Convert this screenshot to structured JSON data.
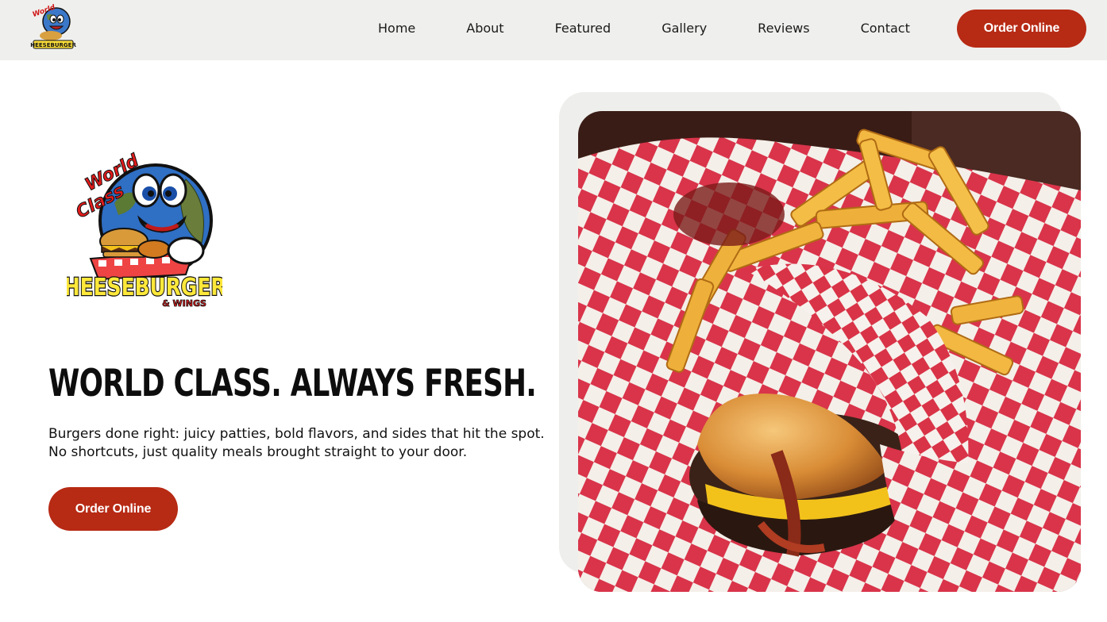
{
  "brand": {
    "logo_text_top": "World Class",
    "logo_text_main": "CHEESEBURGERS",
    "logo_text_sub": "& WINGS"
  },
  "nav": {
    "links": [
      "Home",
      "About",
      "Featured",
      "Gallery",
      "Reviews",
      "Contact"
    ],
    "order_label": "Order Online"
  },
  "hero": {
    "title": "WORLD CLASS. ALWAYS FRESH.",
    "description": "Burgers done right: juicy patties, bold flavors, and sides that hit the spot. No shortcuts, just quality meals brought straight to your door.",
    "order_label": "Order Online"
  },
  "colors": {
    "accent": "#b72a14",
    "nav_background": "#efefed",
    "checker_red": "#d9344a"
  },
  "image": {
    "subject": "cheeseburger-with-bacon-and-crinkle-fries-in-checkered-paper"
  }
}
